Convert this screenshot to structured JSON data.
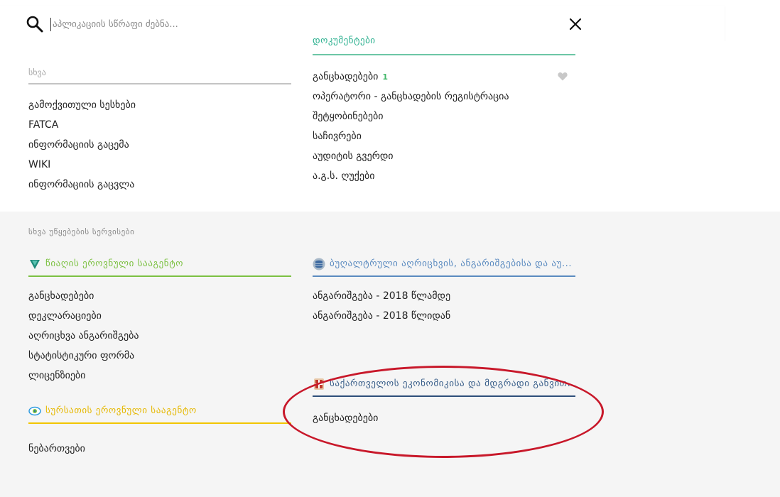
{
  "search": {
    "placeholder": "აპლიკაციის სწრაფი ძებნა...",
    "search_icon": "search-icon",
    "close_icon": "close-icon"
  },
  "top": {
    "other": {
      "title": "სხვა",
      "items": [
        "გამოქვითული სესხები",
        "FATCA",
        "ინფორმაციის გაცემა",
        "WIKI",
        "ინფორმაციის გაცვლა"
      ]
    },
    "right": {
      "cut_heading": "დოკუმენტები",
      "items": [
        {
          "label": "განცხადებები",
          "badge": "1"
        },
        {
          "label": "ოპერატორი - განცხადების რეგისტრაცია"
        },
        {
          "label": "შეტყობინებები"
        },
        {
          "label": "საჩივრები"
        },
        {
          "label": "აუდიტის გვერდი"
        },
        {
          "label": "ა.გ.ს. ღუქები"
        }
      ],
      "favorite_icon": "heart-icon"
    }
  },
  "bottom": {
    "section_title": "სხვა უწყებების სერვისები",
    "blocks": [
      {
        "title": "წიაღის ეროვნული სააგენტო",
        "icon": "drop-shield-icon",
        "accent": "#7cc142",
        "items": [
          "განცხადებები",
          "დეკლარაციები",
          "აღრიცხვა ანგარიშგება",
          "სტატისტიკური ფორმა",
          "ლიცენზიები"
        ]
      },
      {
        "title": "ბუღალტრული აღრიცხვის, ანგარიშგებისა და აუ...",
        "icon": "database-icon",
        "accent": "#5b8bc0",
        "items": [
          "ანგარიშგება - 2018 წლამდე",
          "ანგარიშგება - 2018 წლიდან"
        ]
      },
      {
        "title": "სურსათის ეროვნული სააგენტო",
        "icon": "eye-badge-icon",
        "accent": "#f2c500",
        "items": [
          "ნებართვები"
        ]
      },
      {
        "title": "საქართველოს ეკონომიკისა და მდგრადი განვით...",
        "icon": "georgia-emblem-icon",
        "accent": "#2e4f7a",
        "items": [
          "განცხადებები"
        ]
      }
    ]
  },
  "annotation": {
    "color": "#c8182a",
    "shape": "ellipse"
  },
  "colors": {
    "green_line": "#6cc6a6",
    "gray_line": "#c4c4c4",
    "lower_bg": "#f5f5f5"
  }
}
